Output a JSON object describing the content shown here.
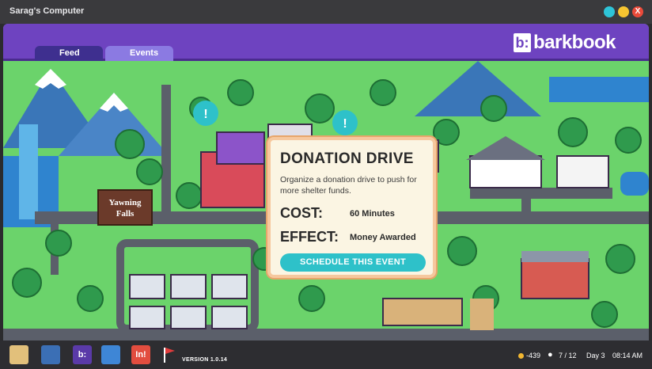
{
  "window": {
    "title": "Sarag's Computer",
    "close_glyph": "X"
  },
  "app": {
    "logo_mark": "b:",
    "logo_text": "barkbook",
    "tabs": [
      {
        "label": "Feed"
      },
      {
        "label": "Events"
      }
    ]
  },
  "map": {
    "sign_line1": "Yawning",
    "sign_line2": "Falls",
    "alert_glyph": "!"
  },
  "event": {
    "title": "DONATION DRIVE",
    "description": "Organize a donation drive to push for more shelter funds.",
    "cost_label": "COST:",
    "cost_value": "60 Minutes",
    "effect_label": "EFFECT:",
    "effect_value": "Money Awarded",
    "button_label": "SCHEDULE THIS EVENT"
  },
  "taskbar": {
    "icons": [
      "dog-treat-icon",
      "basket-icon",
      "barkbook-app-icon",
      "calendar-icon",
      "in-app-icon",
      "red-flag-icon"
    ],
    "in_label": "In!",
    "version": "VERSION 1.0.14",
    "money": "-439",
    "dogs": "7 / 12",
    "day": "Day 3",
    "time": "08:14 AM"
  },
  "colors": {
    "header": "#6e43c0",
    "tab_feed": "#3e2f8f",
    "tab_events": "#8b7ae2",
    "button": "#2ec1c9",
    "grass": "#6bd36b",
    "road": "#5b5f6a"
  }
}
